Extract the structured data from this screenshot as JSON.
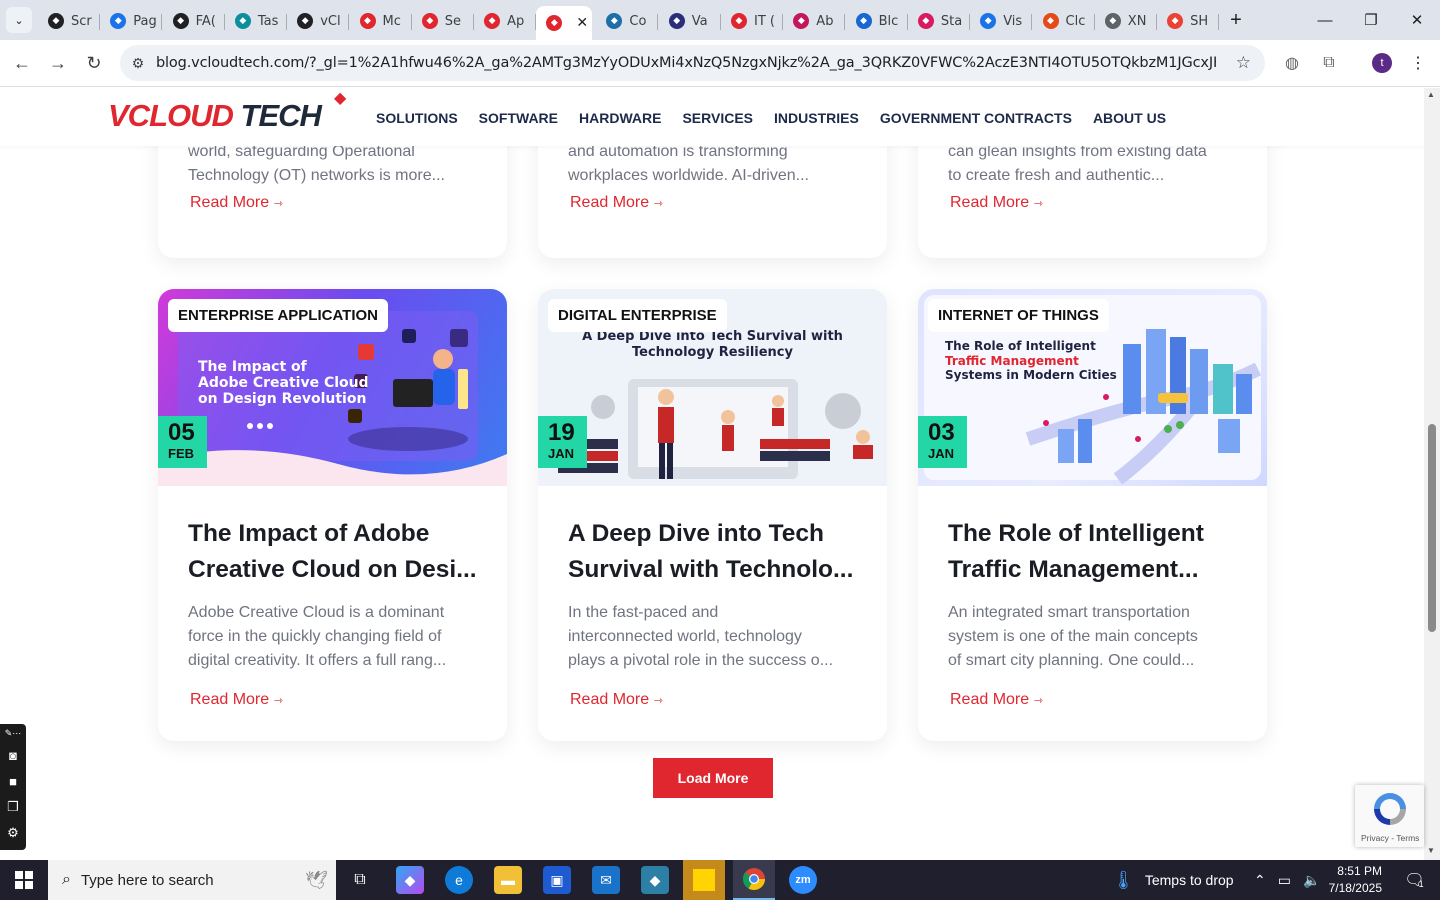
{
  "browser": {
    "tabs": [
      {
        "label": "Scr",
        "color": "#202124"
      },
      {
        "label": "Pag",
        "color": "#1a73e8"
      },
      {
        "label": "FA(",
        "color": "#202124"
      },
      {
        "label": "Tas",
        "color": "#0b8f9c"
      },
      {
        "label": "vCl",
        "color": "#202124"
      },
      {
        "label": "Mc",
        "color": "#e0262f"
      },
      {
        "label": "Se",
        "color": "#e0262f"
      },
      {
        "label": "Ap",
        "color": "#e0262f"
      },
      {
        "label": "",
        "color": "#e0262f"
      },
      {
        "label": "Co",
        "color": "#1d6fa8"
      },
      {
        "label": "Va",
        "color": "#2b2e7a"
      },
      {
        "label": "IT (",
        "color": "#e0262f"
      },
      {
        "label": "Ab",
        "color": "#c2185b"
      },
      {
        "label": "Blc",
        "color": "#1967d2"
      },
      {
        "label": "Sta",
        "color": "#d81b60"
      },
      {
        "label": "Vis",
        "color": "#1a73e8"
      },
      {
        "label": "Clc",
        "color": "#e64a19"
      },
      {
        "label": "XN",
        "color": "#5f6368"
      },
      {
        "label": "SH",
        "color": "#ea4335"
      }
    ],
    "active_tab_index": 8,
    "url": "blog.vcloudtech.com/?_gl=1%2A1hfwu46%2A_ga%2AMTg3MzYyODUxMi4xNzQ5NzgxNjkz%2A_ga_3QRKZ0VFWC%2AczE3NTI4OTU5OTQkbzM1JGcxJHQxNzUyODk2ODk..."
  },
  "site": {
    "logo_part1": "VCLOUD",
    "logo_part2": "TECH",
    "menu": [
      "SOLUTIONS",
      "SOFTWARE",
      "HARDWARE",
      "SERVICES",
      "INDUSTRIES",
      "GOVERNMENT CONTRACTS",
      "ABOUT US"
    ]
  },
  "top_row": [
    {
      "excerpt_1": "world, safeguarding Operational",
      "excerpt_2": "Technology (OT) networks is more...",
      "read_more": "Read More"
    },
    {
      "excerpt_1": "and automation is transforming",
      "excerpt_2": "workplaces worldwide. AI-driven...",
      "read_more": "Read More"
    },
    {
      "excerpt_1": "can glean insights from existing data",
      "excerpt_2": "to create fresh and authentic...",
      "read_more": "Read More"
    }
  ],
  "cards": [
    {
      "category": "ENTERPRISE APPLICATION",
      "day": "05",
      "month": "FEB",
      "title_1": "The Impact of Adobe",
      "title_2": "Creative Cloud on Desi...",
      "excerpt_1": "Adobe Creative Cloud is a dominant",
      "excerpt_2": "force in the quickly changing field of",
      "excerpt_3": "digital creativity. It offers a full rang...",
      "read_more": "Read More",
      "image_text_1": "The Impact of",
      "image_text_2": "Adobe Creative Cloud",
      "image_text_3": "on Design Revolution"
    },
    {
      "category": "DIGITAL ENTERPRISE",
      "day": "19",
      "month": "JAN",
      "title_1": "A Deep Dive into Tech",
      "title_2": "Survival with Technolo...",
      "excerpt_1": "In the fast-paced and",
      "excerpt_2": "interconnected world, technology",
      "excerpt_3": "plays a pivotal role in the success o...",
      "read_more": "Read More",
      "image_text_1": "A Deep Dive into Tech Survival with",
      "image_text_2": "Technology Resiliency"
    },
    {
      "category": "INTERNET OF THINGS",
      "day": "03",
      "month": "JAN",
      "title_1": "The Role of Intelligent",
      "title_2": "Traffic Management...",
      "excerpt_1": "An integrated smart transportation",
      "excerpt_2": "system is one of the main concepts",
      "excerpt_3": "of smart city planning. One could...",
      "read_more": "Read More",
      "image_text_1": "The Role of Intelligent",
      "image_text_2": "Traffic Management",
      "image_text_3": "Systems in Modern Cities"
    }
  ],
  "load_more": "Load More",
  "recaptcha": {
    "links": "Privacy - Terms"
  },
  "taskbar": {
    "search_placeholder": "Type here to search",
    "weather": "Temps to drop",
    "time": "8:51 PM",
    "date": "7/18/2025",
    "notif_count": "1"
  },
  "colors": {
    "brand_red": "#e0262f",
    "date_green": "#23d6a6",
    "navy": "#1e2a4a"
  }
}
